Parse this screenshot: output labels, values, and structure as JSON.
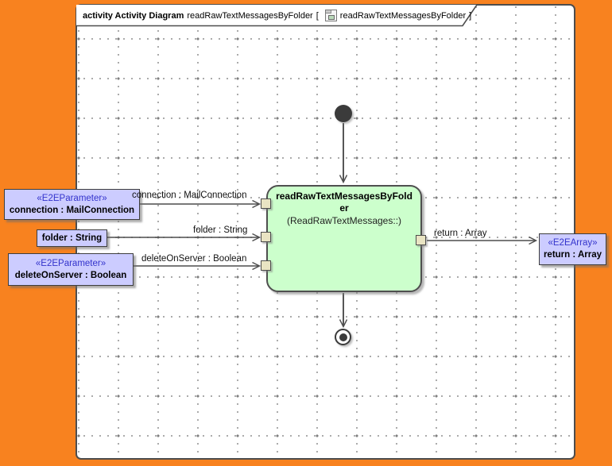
{
  "colors": {
    "background_orange": "#f8821f",
    "activity_fill": "#ccffcc",
    "parameter_fill": "#ccccff",
    "stereotype_blue": "#3333cc",
    "pin_fill": "#e9e4c3",
    "edge_gray": "#4d4d4d"
  },
  "frame_title": {
    "kind": "activity Activity Diagram",
    "name": "readRawTextMessagesByFolder",
    "open_bracket": "[",
    "icon": "activity-diagram-icon",
    "context": "readRawTextMessagesByFolder",
    "close_bracket": "]"
  },
  "activity": {
    "name": "readRawTextMessagesByFolder",
    "namespace": "(ReadRawTextMessages::)"
  },
  "parameters": [
    {
      "stereotype": "«E2EParameter»",
      "label": "connection : MailConnection"
    },
    {
      "stereotype": "",
      "label": "folder : String"
    },
    {
      "stereotype": "«E2EParameter»",
      "label": "deleteOnServer : Boolean"
    }
  ],
  "result": {
    "stereotype": "«E2EArray»",
    "label": "return : Array"
  },
  "edge_labels": {
    "connection": "connection : MailConnection",
    "folder": "folder : String",
    "delete_on_server": "deleteOnServer : Boolean",
    "return": "return : Array"
  }
}
